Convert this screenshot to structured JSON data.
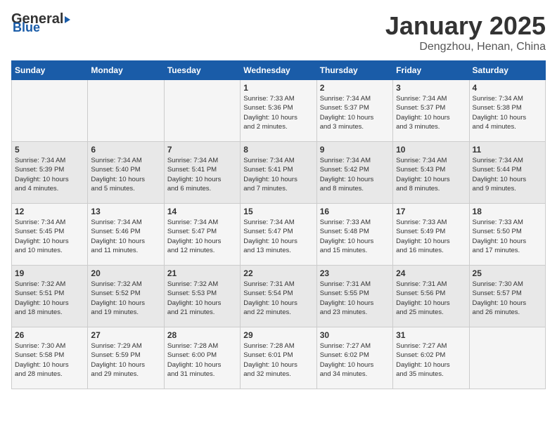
{
  "logo": {
    "general": "General",
    "blue": "Blue",
    "arrow": "▶"
  },
  "header": {
    "title": "January 2025",
    "subtitle": "Dengzhou, Henan, China"
  },
  "columns": [
    "Sunday",
    "Monday",
    "Tuesday",
    "Wednesday",
    "Thursday",
    "Friday",
    "Saturday"
  ],
  "weeks": [
    [
      {
        "day": "",
        "info": ""
      },
      {
        "day": "",
        "info": ""
      },
      {
        "day": "",
        "info": ""
      },
      {
        "day": "1",
        "info": "Sunrise: 7:33 AM\nSunset: 5:36 PM\nDaylight: 10 hours\nand 2 minutes."
      },
      {
        "day": "2",
        "info": "Sunrise: 7:34 AM\nSunset: 5:37 PM\nDaylight: 10 hours\nand 3 minutes."
      },
      {
        "day": "3",
        "info": "Sunrise: 7:34 AM\nSunset: 5:37 PM\nDaylight: 10 hours\nand 3 minutes."
      },
      {
        "day": "4",
        "info": "Sunrise: 7:34 AM\nSunset: 5:38 PM\nDaylight: 10 hours\nand 4 minutes."
      }
    ],
    [
      {
        "day": "5",
        "info": "Sunrise: 7:34 AM\nSunset: 5:39 PM\nDaylight: 10 hours\nand 4 minutes."
      },
      {
        "day": "6",
        "info": "Sunrise: 7:34 AM\nSunset: 5:40 PM\nDaylight: 10 hours\nand 5 minutes."
      },
      {
        "day": "7",
        "info": "Sunrise: 7:34 AM\nSunset: 5:41 PM\nDaylight: 10 hours\nand 6 minutes."
      },
      {
        "day": "8",
        "info": "Sunrise: 7:34 AM\nSunset: 5:41 PM\nDaylight: 10 hours\nand 7 minutes."
      },
      {
        "day": "9",
        "info": "Sunrise: 7:34 AM\nSunset: 5:42 PM\nDaylight: 10 hours\nand 8 minutes."
      },
      {
        "day": "10",
        "info": "Sunrise: 7:34 AM\nSunset: 5:43 PM\nDaylight: 10 hours\nand 8 minutes."
      },
      {
        "day": "11",
        "info": "Sunrise: 7:34 AM\nSunset: 5:44 PM\nDaylight: 10 hours\nand 9 minutes."
      }
    ],
    [
      {
        "day": "12",
        "info": "Sunrise: 7:34 AM\nSunset: 5:45 PM\nDaylight: 10 hours\nand 10 minutes."
      },
      {
        "day": "13",
        "info": "Sunrise: 7:34 AM\nSunset: 5:46 PM\nDaylight: 10 hours\nand 11 minutes."
      },
      {
        "day": "14",
        "info": "Sunrise: 7:34 AM\nSunset: 5:47 PM\nDaylight: 10 hours\nand 12 minutes."
      },
      {
        "day": "15",
        "info": "Sunrise: 7:34 AM\nSunset: 5:47 PM\nDaylight: 10 hours\nand 13 minutes."
      },
      {
        "day": "16",
        "info": "Sunrise: 7:33 AM\nSunset: 5:48 PM\nDaylight: 10 hours\nand 15 minutes."
      },
      {
        "day": "17",
        "info": "Sunrise: 7:33 AM\nSunset: 5:49 PM\nDaylight: 10 hours\nand 16 minutes."
      },
      {
        "day": "18",
        "info": "Sunrise: 7:33 AM\nSunset: 5:50 PM\nDaylight: 10 hours\nand 17 minutes."
      }
    ],
    [
      {
        "day": "19",
        "info": "Sunrise: 7:32 AM\nSunset: 5:51 PM\nDaylight: 10 hours\nand 18 minutes."
      },
      {
        "day": "20",
        "info": "Sunrise: 7:32 AM\nSunset: 5:52 PM\nDaylight: 10 hours\nand 19 minutes."
      },
      {
        "day": "21",
        "info": "Sunrise: 7:32 AM\nSunset: 5:53 PM\nDaylight: 10 hours\nand 21 minutes."
      },
      {
        "day": "22",
        "info": "Sunrise: 7:31 AM\nSunset: 5:54 PM\nDaylight: 10 hours\nand 22 minutes."
      },
      {
        "day": "23",
        "info": "Sunrise: 7:31 AM\nSunset: 5:55 PM\nDaylight: 10 hours\nand 23 minutes."
      },
      {
        "day": "24",
        "info": "Sunrise: 7:31 AM\nSunset: 5:56 PM\nDaylight: 10 hours\nand 25 minutes."
      },
      {
        "day": "25",
        "info": "Sunrise: 7:30 AM\nSunset: 5:57 PM\nDaylight: 10 hours\nand 26 minutes."
      }
    ],
    [
      {
        "day": "26",
        "info": "Sunrise: 7:30 AM\nSunset: 5:58 PM\nDaylight: 10 hours\nand 28 minutes."
      },
      {
        "day": "27",
        "info": "Sunrise: 7:29 AM\nSunset: 5:59 PM\nDaylight: 10 hours\nand 29 minutes."
      },
      {
        "day": "28",
        "info": "Sunrise: 7:28 AM\nSunset: 6:00 PM\nDaylight: 10 hours\nand 31 minutes."
      },
      {
        "day": "29",
        "info": "Sunrise: 7:28 AM\nSunset: 6:01 PM\nDaylight: 10 hours\nand 32 minutes."
      },
      {
        "day": "30",
        "info": "Sunrise: 7:27 AM\nSunset: 6:02 PM\nDaylight: 10 hours\nand 34 minutes."
      },
      {
        "day": "31",
        "info": "Sunrise: 7:27 AM\nSunset: 6:02 PM\nDaylight: 10 hours\nand 35 minutes."
      },
      {
        "day": "",
        "info": ""
      }
    ]
  ]
}
